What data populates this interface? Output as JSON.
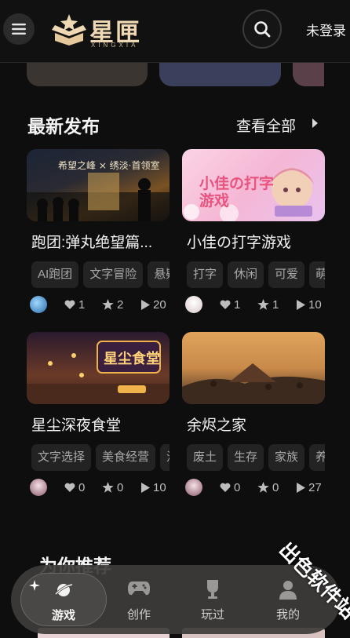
{
  "header": {
    "logo_text": "星匣",
    "logo_sub": "XINGXIA",
    "login_label": "未登录"
  },
  "latest": {
    "title": "最新发布",
    "see_all": "查看全部",
    "cards": [
      {
        "title": "跑团:弹丸绝望篇...",
        "thumb_text": "希望之峰 × 绣淡·首领室",
        "tags": [
          "AI跑团",
          "文字冒险",
          "悬疑"
        ],
        "likes": "1",
        "stars": "2",
        "plays": "20"
      },
      {
        "title": "小佳の打字游戏",
        "thumb_text": "小佳の打字游戏",
        "tags": [
          "打字",
          "休闲",
          "可爱",
          "萌"
        ],
        "likes": "1",
        "stars": "1",
        "plays": "10"
      },
      {
        "title": "星尘深夜食堂",
        "thumb_text": "星尘食堂",
        "tags": [
          "文字选择",
          "美食经营",
          "治愈"
        ],
        "likes": "0",
        "stars": "0",
        "plays": "10"
      },
      {
        "title": "余烬之家",
        "thumb_text": "",
        "tags": [
          "废土",
          "生存",
          "家族",
          "养成"
        ],
        "likes": "0",
        "stars": "0",
        "plays": "27"
      }
    ]
  },
  "recommend": {
    "title": "为你推荐"
  },
  "nav": {
    "items": [
      {
        "label": "游戏"
      },
      {
        "label": "创作"
      },
      {
        "label": "玩过"
      },
      {
        "label": "我的"
      }
    ]
  },
  "watermark": "出色软件站",
  "colors": {
    "accent_gold": "#efd9b4",
    "background": "#0f0e0e",
    "tag_bg": "#242323"
  }
}
